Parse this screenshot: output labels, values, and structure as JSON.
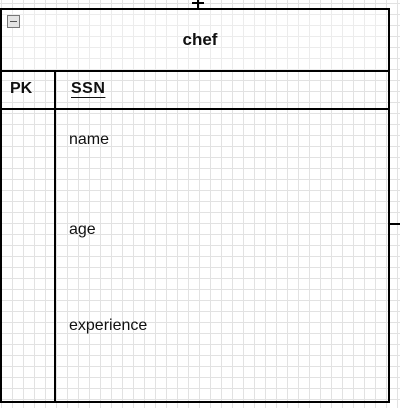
{
  "entity": {
    "title": "chef",
    "pk_label": "PK",
    "pk_field": "SSN",
    "attributes": [
      "name",
      "age",
      "experience"
    ]
  }
}
